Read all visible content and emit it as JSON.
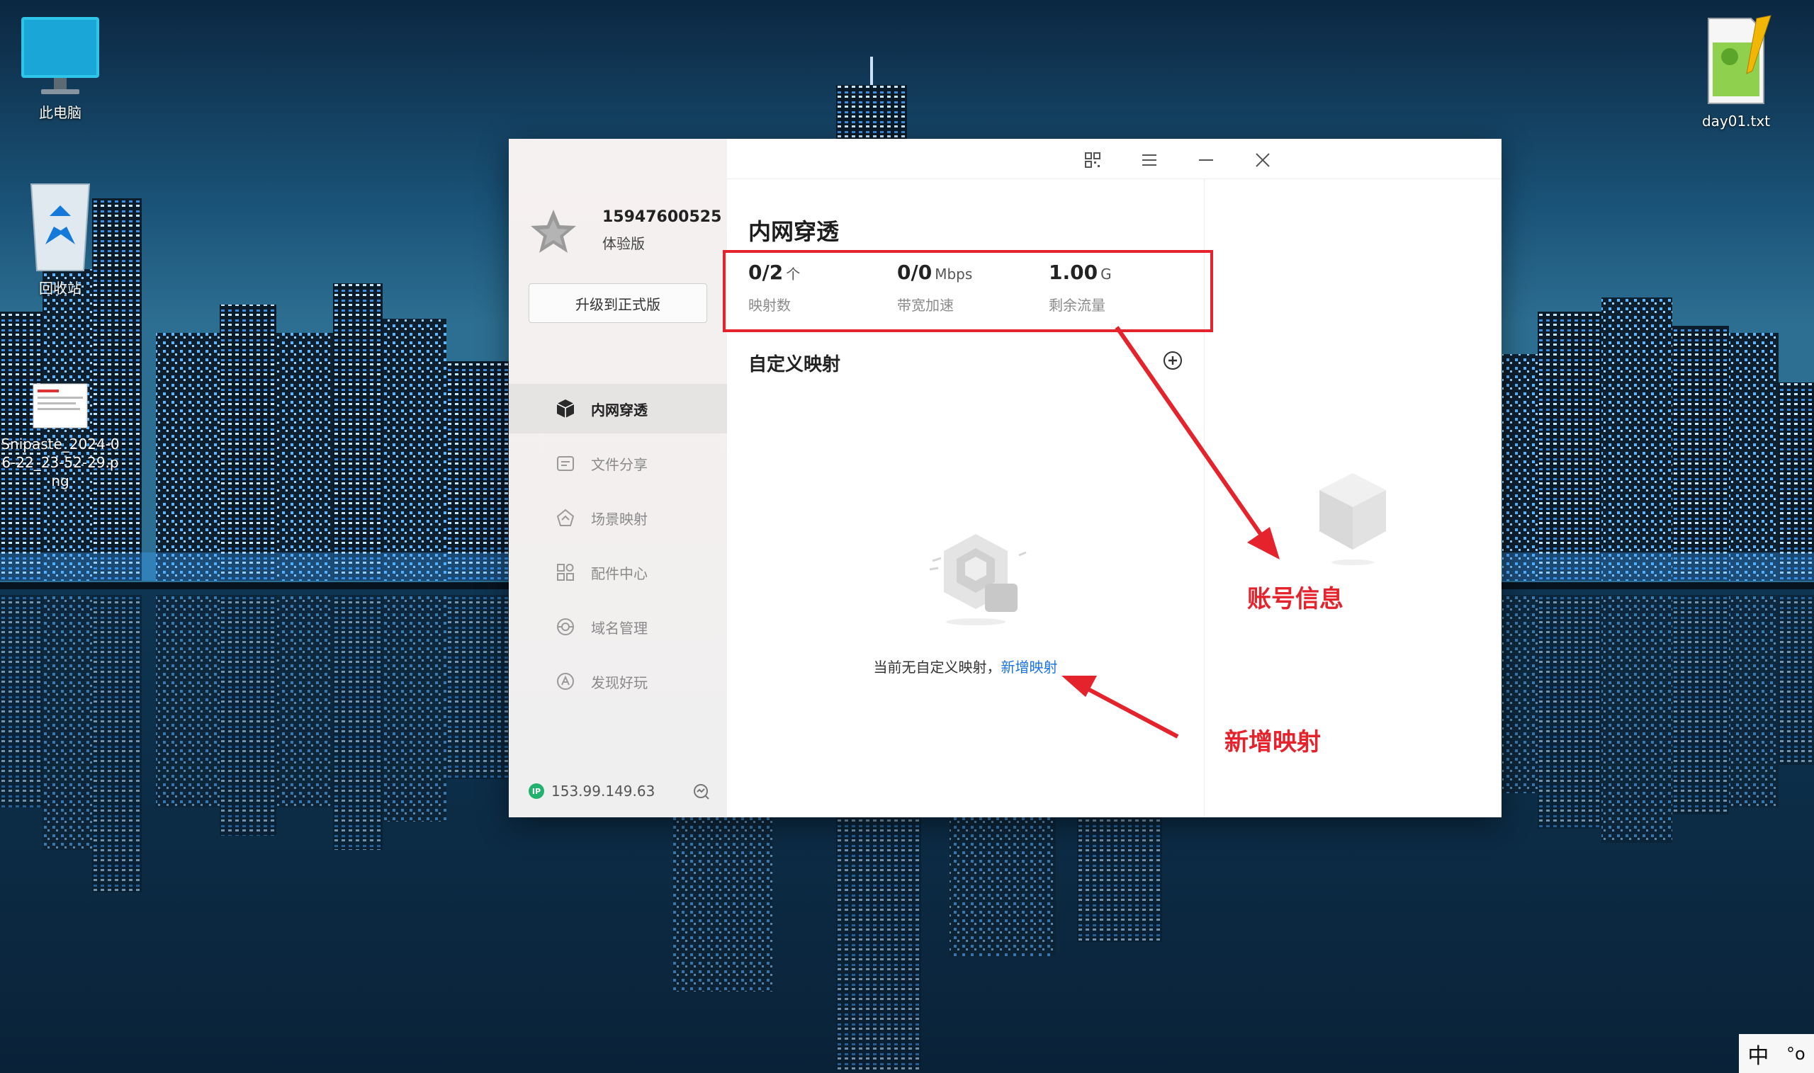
{
  "desktop": {
    "icons": [
      {
        "label": "此电脑",
        "icon": "monitor-icon"
      },
      {
        "label": "回收站",
        "icon": "recycle-bin-icon"
      },
      {
        "label": "Snipaste_2024-06-22_23-52-29.png",
        "icon": "image-file-icon"
      },
      {
        "label": "day01.txt",
        "icon": "notepad-plus-plus-icon"
      }
    ]
  },
  "app": {
    "account": {
      "phone": "15947600525",
      "plan": "体验版",
      "upgrade_label": "升级到正式版"
    },
    "nav": [
      {
        "label": "内网穿透",
        "icon": "cube-icon",
        "active": true
      },
      {
        "label": "文件分享",
        "icon": "file-share-icon",
        "active": false
      },
      {
        "label": "场景映射",
        "icon": "scene-map-icon",
        "active": false
      },
      {
        "label": "配件中心",
        "icon": "grid-icon",
        "active": false
      },
      {
        "label": "域名管理",
        "icon": "domain-icon",
        "active": false
      },
      {
        "label": "发现好玩",
        "icon": "discover-icon",
        "active": false
      }
    ],
    "ip": {
      "badge": "IP",
      "address": "153.99.149.63"
    },
    "titlebar": {
      "icons": [
        "qrcode-icon",
        "menu-icon",
        "minimize-icon",
        "close-icon"
      ]
    },
    "main": {
      "title": "内网穿透",
      "stats": [
        {
          "value": "0/2",
          "unit": "个",
          "label": "映射数"
        },
        {
          "value": "0/0",
          "unit": "Mbps",
          "label": "带宽加速"
        },
        {
          "value": "1.00",
          "unit": "G",
          "label": "剩余流量"
        }
      ],
      "section_title": "自定义映射",
      "empty_text": "当前无自定义映射，",
      "empty_link": "新增映射"
    }
  },
  "annotations": {
    "account_info": "账号信息",
    "add_mapping": "新增映射",
    "color": "#e5232d"
  },
  "taskbar": {
    "ime_label": "中",
    "ime_extra": "°o"
  }
}
